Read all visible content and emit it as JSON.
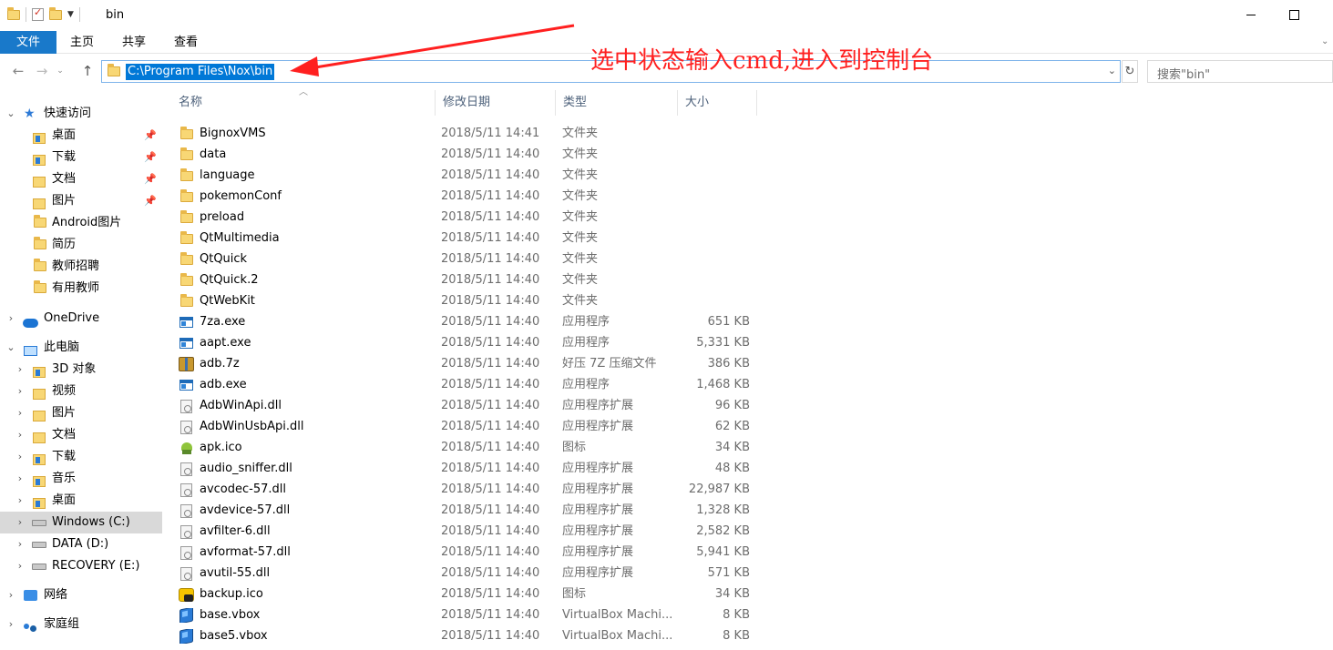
{
  "window": {
    "title": "bin",
    "controls": {
      "minimize": "minimize-icon",
      "maximize": "maximize-icon"
    }
  },
  "ribbon": {
    "tabs": [
      {
        "label": "文件",
        "active": true
      },
      {
        "label": "主页"
      },
      {
        "label": "共享"
      },
      {
        "label": "查看"
      }
    ]
  },
  "address": {
    "path": "C:\\Program Files\\Nox\\bin",
    "selected": true
  },
  "search": {
    "placeholder": "搜索\"bin\""
  },
  "annotation": {
    "text": "选中状态输入cmd,进入到控制台",
    "color": "#ff2020"
  },
  "columns": {
    "name": "名称",
    "date": "修改日期",
    "type": "类型",
    "size": "大小"
  },
  "nav": {
    "quick_access": "快速访问",
    "quick_items": [
      {
        "label": "桌面",
        "pinned": true
      },
      {
        "label": "下载",
        "pinned": true
      },
      {
        "label": "文档",
        "pinned": true
      },
      {
        "label": "图片",
        "pinned": true
      },
      {
        "label": "Android图片",
        "pinned": false
      },
      {
        "label": "简历",
        "pinned": false
      },
      {
        "label": "教师招聘",
        "pinned": false
      },
      {
        "label": "有用教师",
        "pinned": false
      }
    ],
    "onedrive": "OneDrive",
    "this_pc": "此电脑",
    "pc_items": [
      {
        "label": "3D 对象"
      },
      {
        "label": "视频"
      },
      {
        "label": "图片"
      },
      {
        "label": "文档"
      },
      {
        "label": "下载"
      },
      {
        "label": "音乐"
      },
      {
        "label": "桌面"
      },
      {
        "label": "Windows (C:)",
        "selected": true
      },
      {
        "label": "DATA (D:)"
      },
      {
        "label": "RECOVERY (E:)"
      }
    ],
    "network": "网络",
    "homegroup": "家庭组"
  },
  "files": [
    {
      "name": "BignoxVMS",
      "date": "2018/5/11 14:41",
      "type": "文件夹",
      "size": "",
      "icon": "folder"
    },
    {
      "name": "data",
      "date": "2018/5/11 14:40",
      "type": "文件夹",
      "size": "",
      "icon": "folder"
    },
    {
      "name": "language",
      "date": "2018/5/11 14:40",
      "type": "文件夹",
      "size": "",
      "icon": "folder"
    },
    {
      "name": "pokemonConf",
      "date": "2018/5/11 14:40",
      "type": "文件夹",
      "size": "",
      "icon": "folder"
    },
    {
      "name": "preload",
      "date": "2018/5/11 14:40",
      "type": "文件夹",
      "size": "",
      "icon": "folder"
    },
    {
      "name": "QtMultimedia",
      "date": "2018/5/11 14:40",
      "type": "文件夹",
      "size": "",
      "icon": "folder"
    },
    {
      "name": "QtQuick",
      "date": "2018/5/11 14:40",
      "type": "文件夹",
      "size": "",
      "icon": "folder"
    },
    {
      "name": "QtQuick.2",
      "date": "2018/5/11 14:40",
      "type": "文件夹",
      "size": "",
      "icon": "folder"
    },
    {
      "name": "QtWebKit",
      "date": "2018/5/11 14:40",
      "type": "文件夹",
      "size": "",
      "icon": "folder"
    },
    {
      "name": "7za.exe",
      "date": "2018/5/11 14:40",
      "type": "应用程序",
      "size": "651 KB",
      "icon": "exe"
    },
    {
      "name": "aapt.exe",
      "date": "2018/5/11 14:40",
      "type": "应用程序",
      "size": "5,331 KB",
      "icon": "exe"
    },
    {
      "name": "adb.7z",
      "date": "2018/5/11 14:40",
      "type": "好压 7Z 压缩文件",
      "size": "386 KB",
      "icon": "7z"
    },
    {
      "name": "adb.exe",
      "date": "2018/5/11 14:40",
      "type": "应用程序",
      "size": "1,468 KB",
      "icon": "exe"
    },
    {
      "name": "AdbWinApi.dll",
      "date": "2018/5/11 14:40",
      "type": "应用程序扩展",
      "size": "96 KB",
      "icon": "dll"
    },
    {
      "name": "AdbWinUsbApi.dll",
      "date": "2018/5/11 14:40",
      "type": "应用程序扩展",
      "size": "62 KB",
      "icon": "dll"
    },
    {
      "name": "apk.ico",
      "date": "2018/5/11 14:40",
      "type": "图标",
      "size": "34 KB",
      "icon": "apk"
    },
    {
      "name": "audio_sniffer.dll",
      "date": "2018/5/11 14:40",
      "type": "应用程序扩展",
      "size": "48 KB",
      "icon": "dll"
    },
    {
      "name": "avcodec-57.dll",
      "date": "2018/5/11 14:40",
      "type": "应用程序扩展",
      "size": "22,987 KB",
      "icon": "dll"
    },
    {
      "name": "avdevice-57.dll",
      "date": "2018/5/11 14:40",
      "type": "应用程序扩展",
      "size": "1,328 KB",
      "icon": "dll"
    },
    {
      "name": "avfilter-6.dll",
      "date": "2018/5/11 14:40",
      "type": "应用程序扩展",
      "size": "2,582 KB",
      "icon": "dll"
    },
    {
      "name": "avformat-57.dll",
      "date": "2018/5/11 14:40",
      "type": "应用程序扩展",
      "size": "5,941 KB",
      "icon": "dll"
    },
    {
      "name": "avutil-55.dll",
      "date": "2018/5/11 14:40",
      "type": "应用程序扩展",
      "size": "571 KB",
      "icon": "dll"
    },
    {
      "name": "backup.ico",
      "date": "2018/5/11 14:40",
      "type": "图标",
      "size": "34 KB",
      "icon": "backup"
    },
    {
      "name": "base.vbox",
      "date": "2018/5/11 14:40",
      "type": "VirtualBox Machi...",
      "size": "8 KB",
      "icon": "vbox"
    },
    {
      "name": "base5.vbox",
      "date": "2018/5/11 14:40",
      "type": "VirtualBox Machi...",
      "size": "8 KB",
      "icon": "vbox"
    }
  ]
}
